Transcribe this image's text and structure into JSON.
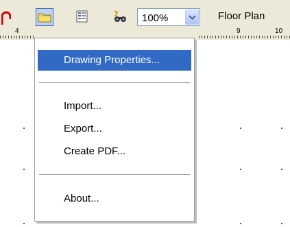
{
  "toolbar": {
    "buttons": [
      {
        "name": "open-folder-button",
        "icon": "folder-icon",
        "pressed": true
      },
      {
        "name": "form-button",
        "icon": "form-icon",
        "pressed": false
      },
      {
        "name": "find-button",
        "icon": "binoculars-icon",
        "pressed": false
      }
    ],
    "zoom": {
      "value": "100%",
      "icon": "dropdown-arrow-icon"
    },
    "sheet_label": "Floor Plan",
    "colors": {
      "toolbar_bg": "#ece9d8",
      "pressed_bg": "#c1d2ee",
      "accent": "#316ac5"
    }
  },
  "ruler": {
    "labels": [
      "4",
      "9",
      "10"
    ]
  },
  "menu": {
    "items": [
      {
        "label": "Drawing Properties...",
        "active": true
      },
      {
        "label": "Import...",
        "active": false
      },
      {
        "label": "Export...",
        "active": false
      },
      {
        "label": "Create PDF...",
        "active": false
      },
      {
        "label": "About...",
        "active": false
      }
    ],
    "highlight_color": "#316ac5"
  }
}
